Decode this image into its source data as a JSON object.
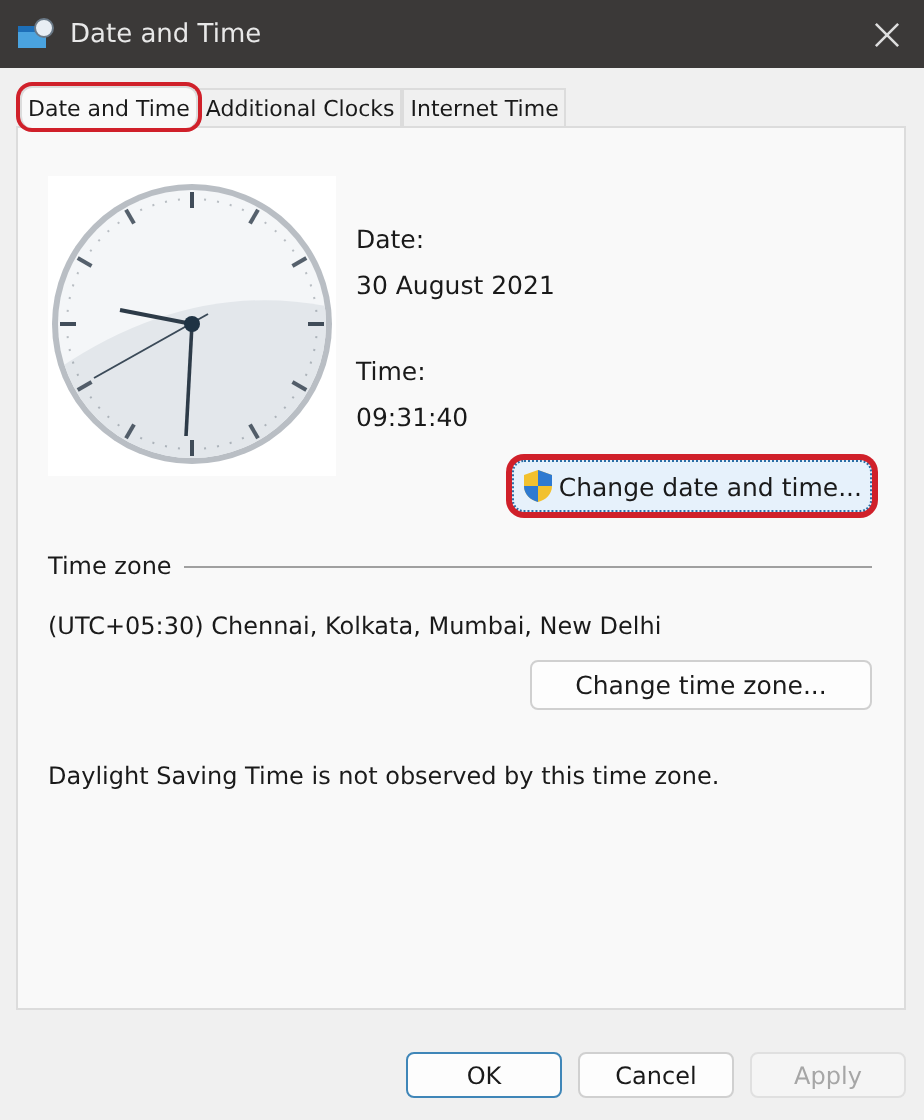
{
  "window": {
    "title": "Date and Time"
  },
  "tabs": [
    {
      "label": "Date and Time",
      "selected": true,
      "highlighted": true
    },
    {
      "label": "Additional Clocks",
      "selected": false,
      "highlighted": false
    },
    {
      "label": "Internet Time",
      "selected": false,
      "highlighted": false
    }
  ],
  "date": {
    "label": "Date:",
    "value": "30 August 2021"
  },
  "time": {
    "label": "Time:",
    "value": "09:31:40"
  },
  "change_date_button": {
    "label": "Change date and time...",
    "highlighted": true
  },
  "time_zone": {
    "heading": "Time zone",
    "value": "(UTC+05:30) Chennai, Kolkata, Mumbai, New Delhi",
    "button": "Change time zone..."
  },
  "dst_note": "Daylight Saving Time is not observed by this time zone.",
  "buttons": [
    {
      "label": "OK",
      "kind": "default",
      "disabled": false
    },
    {
      "label": "Cancel",
      "kind": "normal",
      "disabled": false
    },
    {
      "label": "Apply",
      "kind": "normal",
      "disabled": true
    }
  ]
}
